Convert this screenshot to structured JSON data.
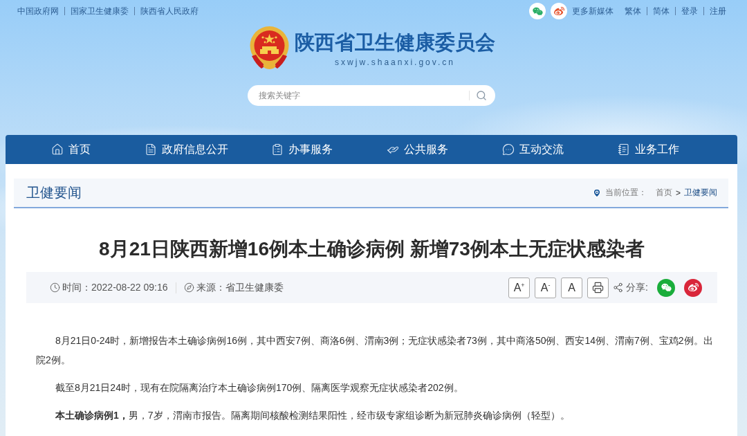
{
  "top_links": [
    "中国政府网",
    "国家卫生健康委",
    "陕西省人民政府"
  ],
  "media_link": "更多新媒体",
  "account_links": [
    "繁体",
    "简体",
    "登录",
    "注册"
  ],
  "site": {
    "title": "陕西省卫生健康委员会",
    "domain": "sxwjw.shaanxi.gov.cn"
  },
  "search": {
    "placeholder": "搜索关键字"
  },
  "nav": [
    "首页",
    "政府信息公开",
    "办事服务",
    "公共服务",
    "互动交流",
    "业务工作"
  ],
  "section": {
    "title": "卫健要闻",
    "location_label": "当前位置：",
    "breadcrumb": [
      "首页",
      "卫健要闻"
    ],
    "breadcrumb_separator": ">"
  },
  "article": {
    "title": "8月21日陕西新增16例本土确诊病例 新增73例本土无症状感染者",
    "time": "时间：2022-08-22 09:16",
    "source": "来源：省卫生健康委",
    "font_buttons": [
      "A$^{+}$",
      "A$^{-}$",
      "A"
    ],
    "share_label": "分享:",
    "paragraphs": [
      "8月21日0-24时，新增报告本土确诊病例16例，其中西安7例、商洛6例、渭南3例；无症状感染者73例，其中商洛50例、西安14例、渭南7例、宝鸡2例。出院2例。",
      "截至8月21日24时，现有在院隔离治疗本土确诊病例170例、隔离医学观察无症状感染者202例。",
      "**本土确诊病例1，**男，7岁，渭南市报告。隔离期间核酸检测结果阳性，经市级专家组诊断为新冠肺炎确诊病例（轻型）。"
    ]
  }
}
